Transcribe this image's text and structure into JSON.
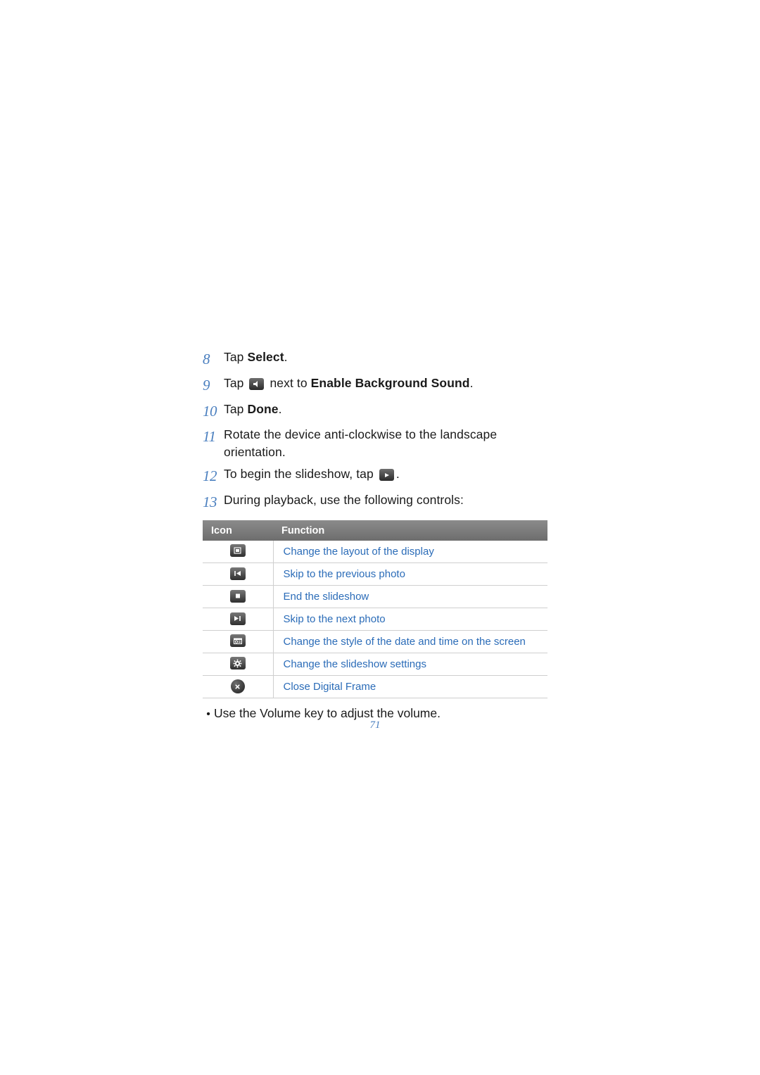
{
  "steps": [
    {
      "num": "8",
      "pre": "Tap ",
      "bold": "Select",
      "post": ".",
      "icon": null
    },
    {
      "num": "9",
      "pre": "Tap ",
      "icon": "background-sound-icon",
      "mid": " next to ",
      "bold": "Enable Background Sound",
      "post": "."
    },
    {
      "num": "10",
      "pre": "Tap ",
      "bold": "Done",
      "post": ".",
      "icon": null
    },
    {
      "num": "11",
      "pre": "Rotate the device anti-clockwise to the landscape orientation.",
      "bold": "",
      "post": "",
      "icon": null
    },
    {
      "num": "12",
      "pre": "To begin the slideshow, tap ",
      "icon": "play-icon",
      "mid": "",
      "bold": "",
      "post": "."
    },
    {
      "num": "13",
      "pre": "During playback, use the following controls:",
      "bold": "",
      "post": "",
      "icon": null
    }
  ],
  "table": {
    "headers": {
      "icon": "Icon",
      "function": "Function"
    },
    "rows": [
      {
        "icon": "layout-icon",
        "function": "Change the layout of the display"
      },
      {
        "icon": "previous-icon",
        "function": "Skip to the previous photo"
      },
      {
        "icon": "stop-icon",
        "function": "End the slideshow"
      },
      {
        "icon": "next-icon",
        "function": "Skip to the next photo"
      },
      {
        "icon": "date-time-icon",
        "function": "Change the style of the date and time on the screen"
      },
      {
        "icon": "settings-gear-icon",
        "function": "Change the slideshow settings"
      },
      {
        "icon": "close-icon",
        "function": "Close Digital Frame"
      }
    ]
  },
  "bullet": "Use the Volume key to adjust the volume.",
  "page_number": "71",
  "colors": {
    "link": "#2b6cb8",
    "number": "#4a7fbf",
    "header_bg": "#7a7a7a"
  }
}
